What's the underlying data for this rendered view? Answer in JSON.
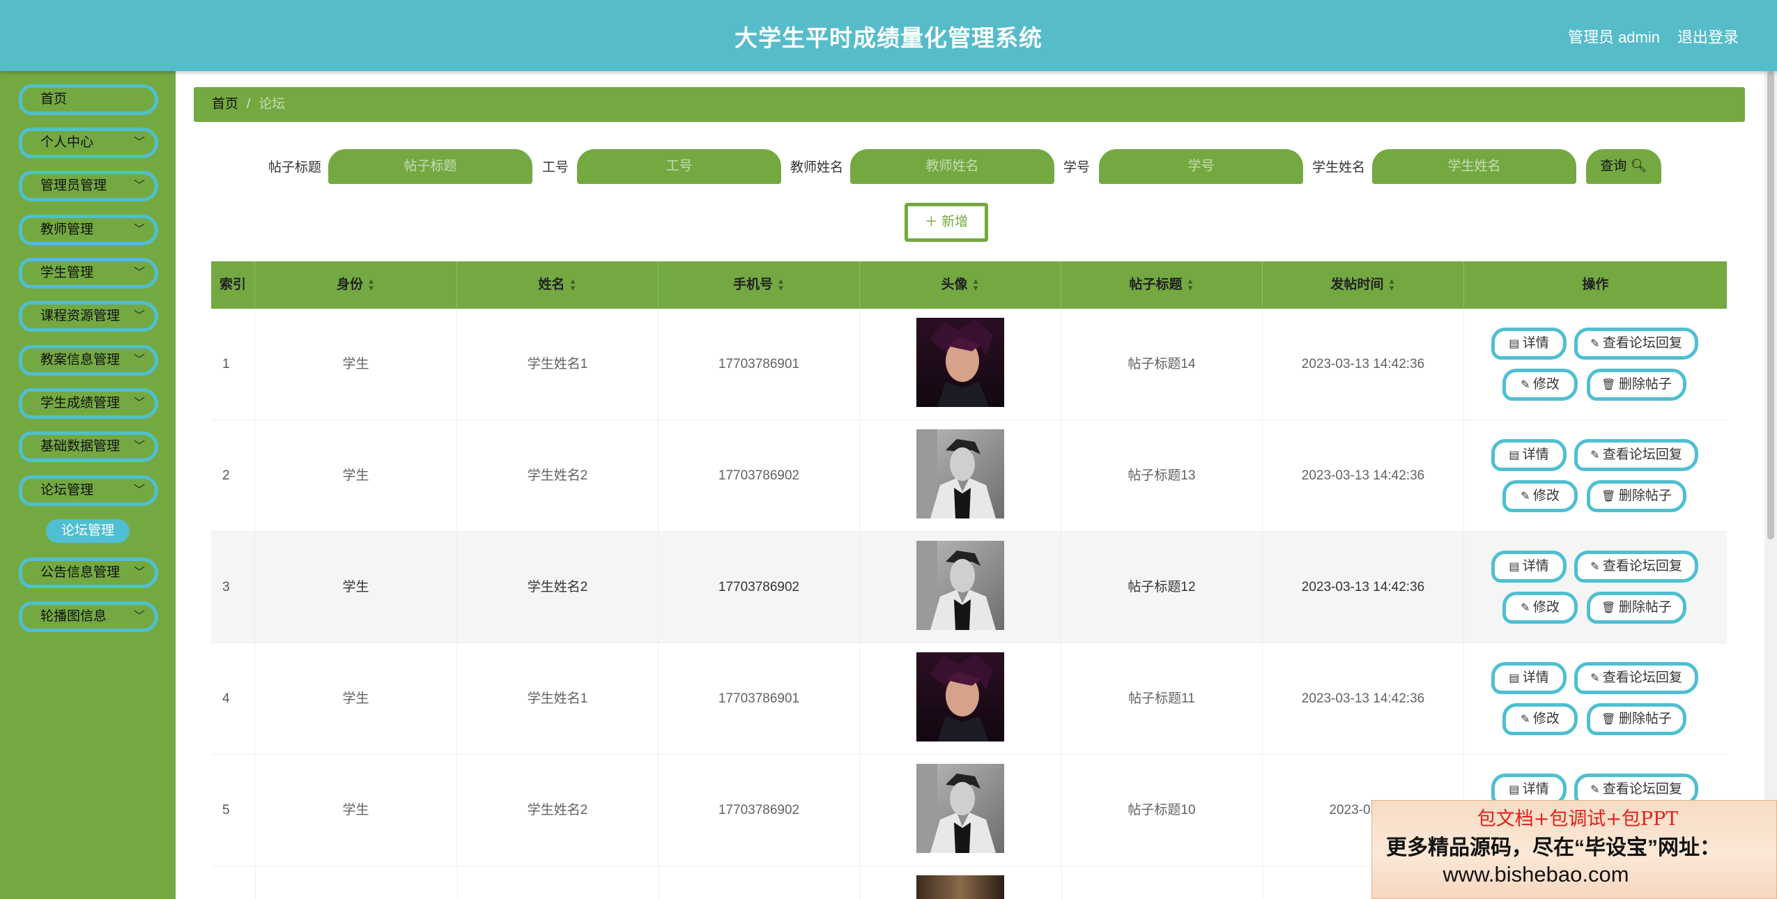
{
  "header": {
    "title": "大学生平时成绩量化管理系统",
    "user": "管理员 admin",
    "logout": "退出登录"
  },
  "sidebar": {
    "items": [
      {
        "label": "首页",
        "has_chevron": false
      },
      {
        "label": "个人中心",
        "has_chevron": true
      },
      {
        "label": "管理员管理",
        "has_chevron": true
      },
      {
        "label": "教师管理",
        "has_chevron": true
      },
      {
        "label": "学生管理",
        "has_chevron": true
      },
      {
        "label": "课程资源管理",
        "has_chevron": true
      },
      {
        "label": "教案信息管理",
        "has_chevron": true
      },
      {
        "label": "学生成绩管理",
        "has_chevron": true
      },
      {
        "label": "基础数据管理",
        "has_chevron": true
      },
      {
        "label": "论坛管理",
        "has_chevron": true
      },
      {
        "label": "公告信息管理",
        "has_chevron": true
      },
      {
        "label": "轮播图信息",
        "has_chevron": true
      }
    ],
    "active_sub": "论坛管理"
  },
  "breadcrumb": {
    "home": "首页",
    "separator": "/",
    "current": "论坛"
  },
  "search": {
    "fields": [
      {
        "label": "帖子标题",
        "placeholder": "帖子标题"
      },
      {
        "label": "工号",
        "placeholder": "工号"
      },
      {
        "label": "教师姓名",
        "placeholder": "教师姓名"
      },
      {
        "label": "学号",
        "placeholder": "学号"
      },
      {
        "label": "学生姓名",
        "placeholder": "学生姓名"
      }
    ],
    "query_label": "查询",
    "add_label": "新增"
  },
  "table": {
    "columns": [
      "索引",
      "身份",
      "姓名",
      "手机号",
      "头像",
      "帖子标题",
      "发帖时间",
      "操作"
    ],
    "sortable": [
      false,
      true,
      true,
      true,
      true,
      true,
      true,
      false
    ],
    "rows": [
      {
        "index": "1",
        "role": "学生",
        "name": "学生姓名1",
        "phone": "17703786901",
        "avatar": "avatar-a",
        "title": "帖子标题14",
        "time": "2023-03-13 14:42:36"
      },
      {
        "index": "2",
        "role": "学生",
        "name": "学生姓名2",
        "phone": "17703786902",
        "avatar": "avatar-b",
        "title": "帖子标题13",
        "time": "2023-03-13 14:42:36"
      },
      {
        "index": "3",
        "role": "学生",
        "name": "学生姓名2",
        "phone": "17703786902",
        "avatar": "avatar-b",
        "title": "帖子标题12",
        "time": "2023-03-13 14:42:36"
      },
      {
        "index": "4",
        "role": "学生",
        "name": "学生姓名1",
        "phone": "17703786901",
        "avatar": "avatar-a",
        "title": "帖子标题11",
        "time": "2023-03-13 14:42:36"
      },
      {
        "index": "5",
        "role": "学生",
        "name": "学生姓名2",
        "phone": "17703786902",
        "avatar": "avatar-b",
        "title": "帖子标题10",
        "time": "2023-03-13"
      }
    ],
    "actions": {
      "detail": "详情",
      "view_reply": "查看论坛回复",
      "edit": "修改",
      "delete": "删除帖子"
    }
  },
  "ad": {
    "line1": "包文档+包调试+包PPT",
    "line2": "更多精品源码，尽在“毕设宝”网址：",
    "line3": "www.bishebao.com"
  },
  "colors": {
    "header": "#56bcca",
    "green": "#74a942",
    "cyan_border": "#4fbfd1"
  }
}
